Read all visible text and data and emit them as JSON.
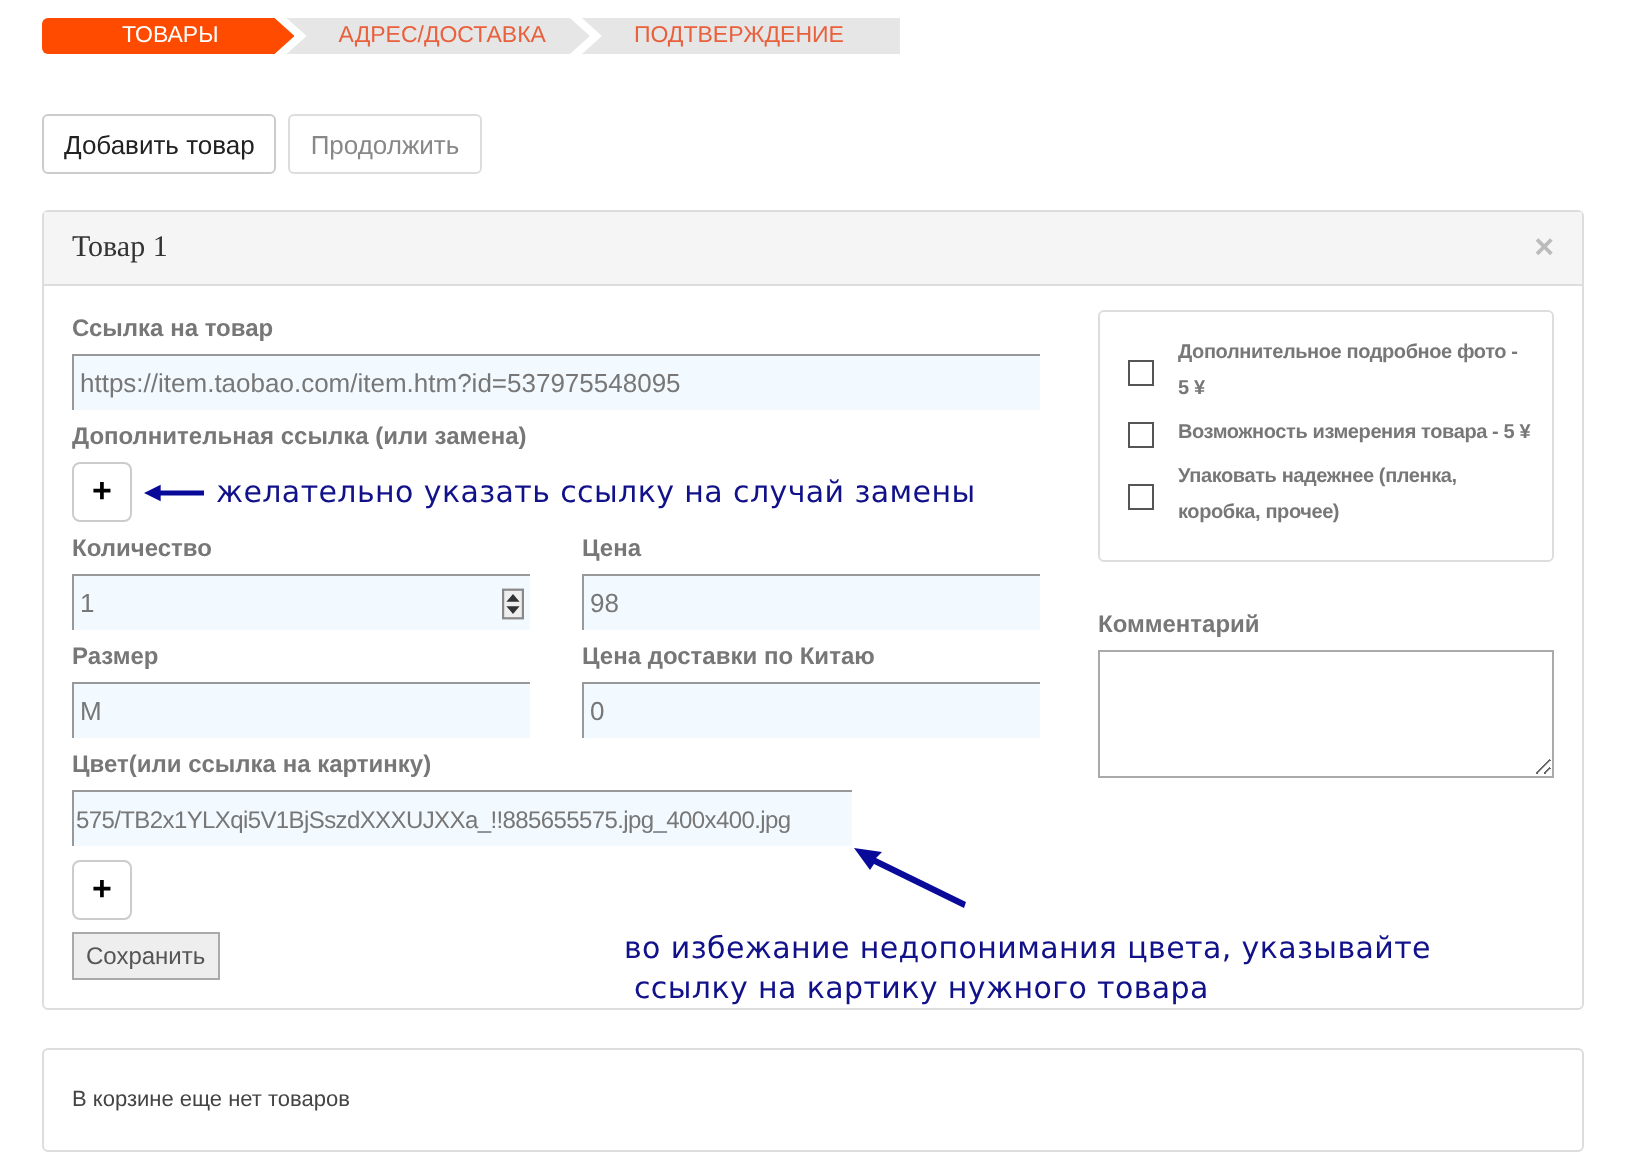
{
  "steps": [
    {
      "label": "ТОВАРЫ",
      "selected": true
    },
    {
      "label": "АДРЕС/ДОСТАВКА",
      "selected": false
    },
    {
      "label": "ПОДТВЕРЖДЕНИЕ",
      "selected": false
    }
  ],
  "buttons": [
    {
      "label": "Добавить товар",
      "disabled": false
    },
    {
      "label": "Продолжить",
      "disabled": true
    }
  ],
  "item_panel": {
    "title": "Товар 1",
    "close": "×",
    "link_label": "Ссылка на товар",
    "link_value": "https://item.taobao.com/item.htm?id=537975548095",
    "extra_link_label": "Дополнительная ссылка (или замена)",
    "add_symbol": "+",
    "extra_note": "желательно указать ссылку на случай замены",
    "pairs": [
      {
        "label": "Количество",
        "value": "1",
        "kind": "spinner"
      },
      {
        "label": "Цена",
        "value": "98",
        "kind": "text"
      },
      {
        "label": "Размер",
        "value": "M",
        "kind": "text"
      },
      {
        "label": "Цена доставки по Китаю",
        "value": "0",
        "kind": "text"
      }
    ],
    "color_label": "Цвет(или ссылка на картинку)",
    "color_value": "575/TB2x1YLXqi5V1BjSszdXXXUJXXa_!!885655575.jpg_400x400.jpg",
    "color_add_symbol": "+",
    "save": "Сохранить",
    "color_note": "во избежание недопонимания цвета, указывайте\n ссылку на картику нужного товара",
    "options": [
      {
        "label": "Дополнительное подробное фото - 5 ¥",
        "checked": false
      },
      {
        "label": "Возможность измерения товара - 5 ¥",
        "checked": false
      },
      {
        "label": "Упаковать надежнее (пленка, коробка, прочее)",
        "checked": false
      }
    ],
    "comment_label": "Комментарий"
  },
  "cart_message": "В корзине еще нет товаров"
}
